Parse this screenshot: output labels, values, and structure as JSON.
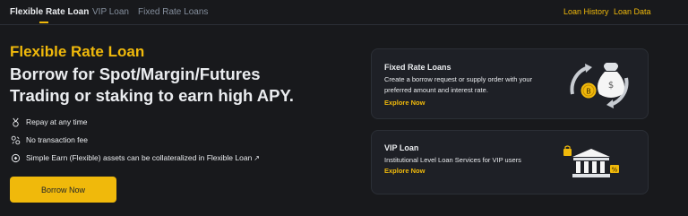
{
  "nav": {
    "tabs": [
      {
        "label": "Flexible Rate Loan",
        "active": true
      },
      {
        "label": "VIP Loan",
        "active": false
      },
      {
        "label": "Fixed Rate Loans",
        "active": false
      }
    ],
    "links": [
      "Loan History",
      "Loan Data"
    ]
  },
  "hero": {
    "label": "Flexible Rate Loan",
    "title": "Borrow for Spot/Margin/Futures Trading or staking to earn high APY."
  },
  "features": [
    {
      "icon": "medal-icon",
      "text": "Repay at any time"
    },
    {
      "icon": "no-fee-icon",
      "text": "No transaction fee"
    },
    {
      "icon": "earn-icon",
      "text": "Simple Earn (Flexible) assets can be collateralized in Flexible Loan"
    }
  ],
  "feature_link_icon": "↗",
  "cta": {
    "borrow_label": "Borrow Now"
  },
  "cards": [
    {
      "title": "Fixed Rate Loans",
      "description": "Create a borrow request or supply order with your preferred amount and interest rate.",
      "link": "Explore Now",
      "illustration": "money-bag-coin-icon"
    },
    {
      "title": "VIP Loan",
      "description": "Institutional Level Loan Services for VIP users",
      "link": "Explore Now",
      "illustration": "bank-building-icon"
    }
  ],
  "colors": {
    "background": "#18191c",
    "accent": "#f0b90b",
    "card": "#1e2026",
    "text": "#eaecef",
    "muted": "#848e9c"
  }
}
